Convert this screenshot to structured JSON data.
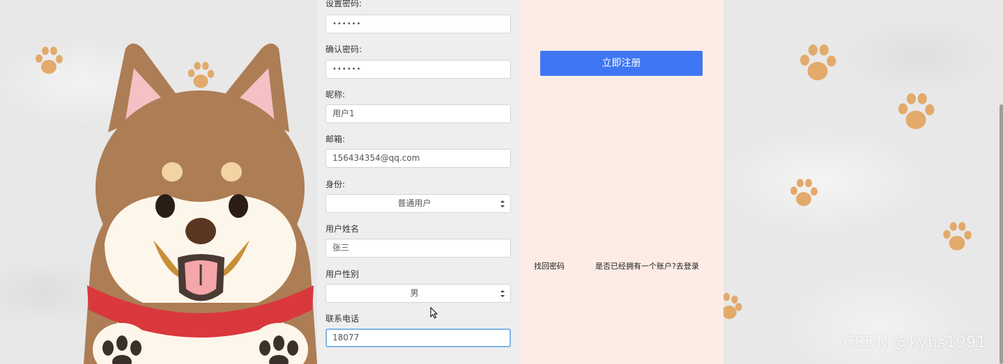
{
  "form": {
    "fields": [
      {
        "label": "设置密码:",
        "value": "••••••"
      },
      {
        "label": "确认密码:",
        "value": "••••••"
      },
      {
        "label": "昵称:",
        "value": "用户1"
      },
      {
        "label": "邮箱:",
        "value": "156434354@qq.com"
      },
      {
        "label": "身份:",
        "value": "普通用户"
      },
      {
        "label": "用户姓名",
        "value": "张三"
      },
      {
        "label": "用户性别",
        "value": "男"
      },
      {
        "label": "联系电话",
        "value": "18077"
      }
    ]
  },
  "side": {
    "register_label": "立即注册",
    "find_password": "找回密码",
    "login_link": "是否已经拥有一个账户?去登录"
  },
  "watermark": "CSDN @kybs1991",
  "colors": {
    "form_bg": "#efeeef",
    "side_bg": "#fdece5",
    "button": "#3f76f4",
    "paw": "#e2aa6b",
    "focus_border": "#80b6e6"
  }
}
